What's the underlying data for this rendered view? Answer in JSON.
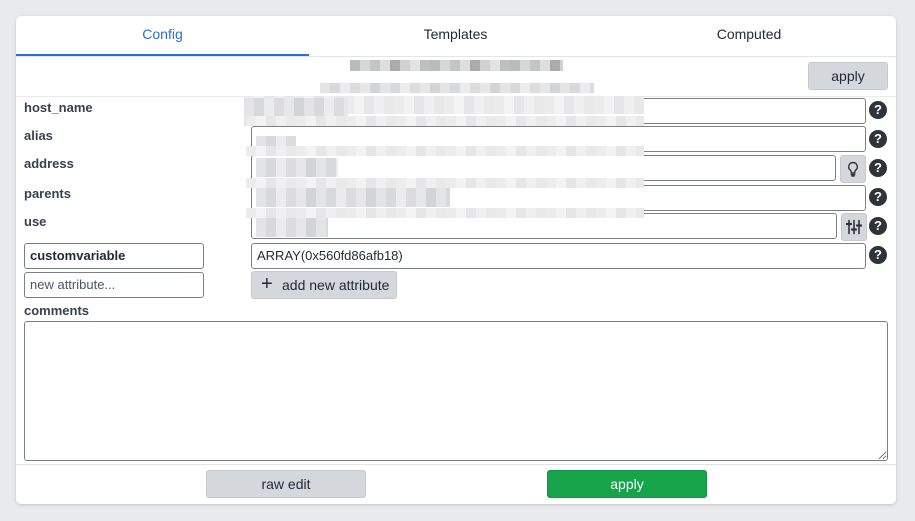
{
  "tabs": [
    {
      "label": "Config",
      "active": true
    },
    {
      "label": "Templates",
      "active": false
    },
    {
      "label": "Computed",
      "active": false
    }
  ],
  "header": {
    "apply_label": "apply"
  },
  "fields": {
    "host_name": {
      "label": "host_name",
      "value": ""
    },
    "alias": {
      "label": "alias",
      "value": ""
    },
    "address": {
      "label": "address",
      "value": ""
    },
    "parents": {
      "label": "parents",
      "value": ""
    },
    "use": {
      "label": "use",
      "value": ""
    },
    "customvariable": {
      "label": "customvariable",
      "value": "ARRAY(0x560fd86afb18)"
    }
  },
  "new_attribute": {
    "placeholder": "new attribute...",
    "add_label": "add new attribute"
  },
  "comments": {
    "label": "comments",
    "value": ""
  },
  "footer": {
    "raw_edit_label": "raw edit",
    "apply_label": "apply"
  },
  "icons": {
    "help": "question-circle-icon",
    "address_action": "lightbulb-icon",
    "use_action": "sliders-icon",
    "add": "plus-icon",
    "resize": "resize-grip-icon"
  },
  "help_glyph": "?",
  "plus_glyph": "+",
  "colors": {
    "accent": "#2b6fd6",
    "apply_green": "#16a34a",
    "button_gray": "#d4d7dc",
    "help_dark": "#2f343b"
  }
}
